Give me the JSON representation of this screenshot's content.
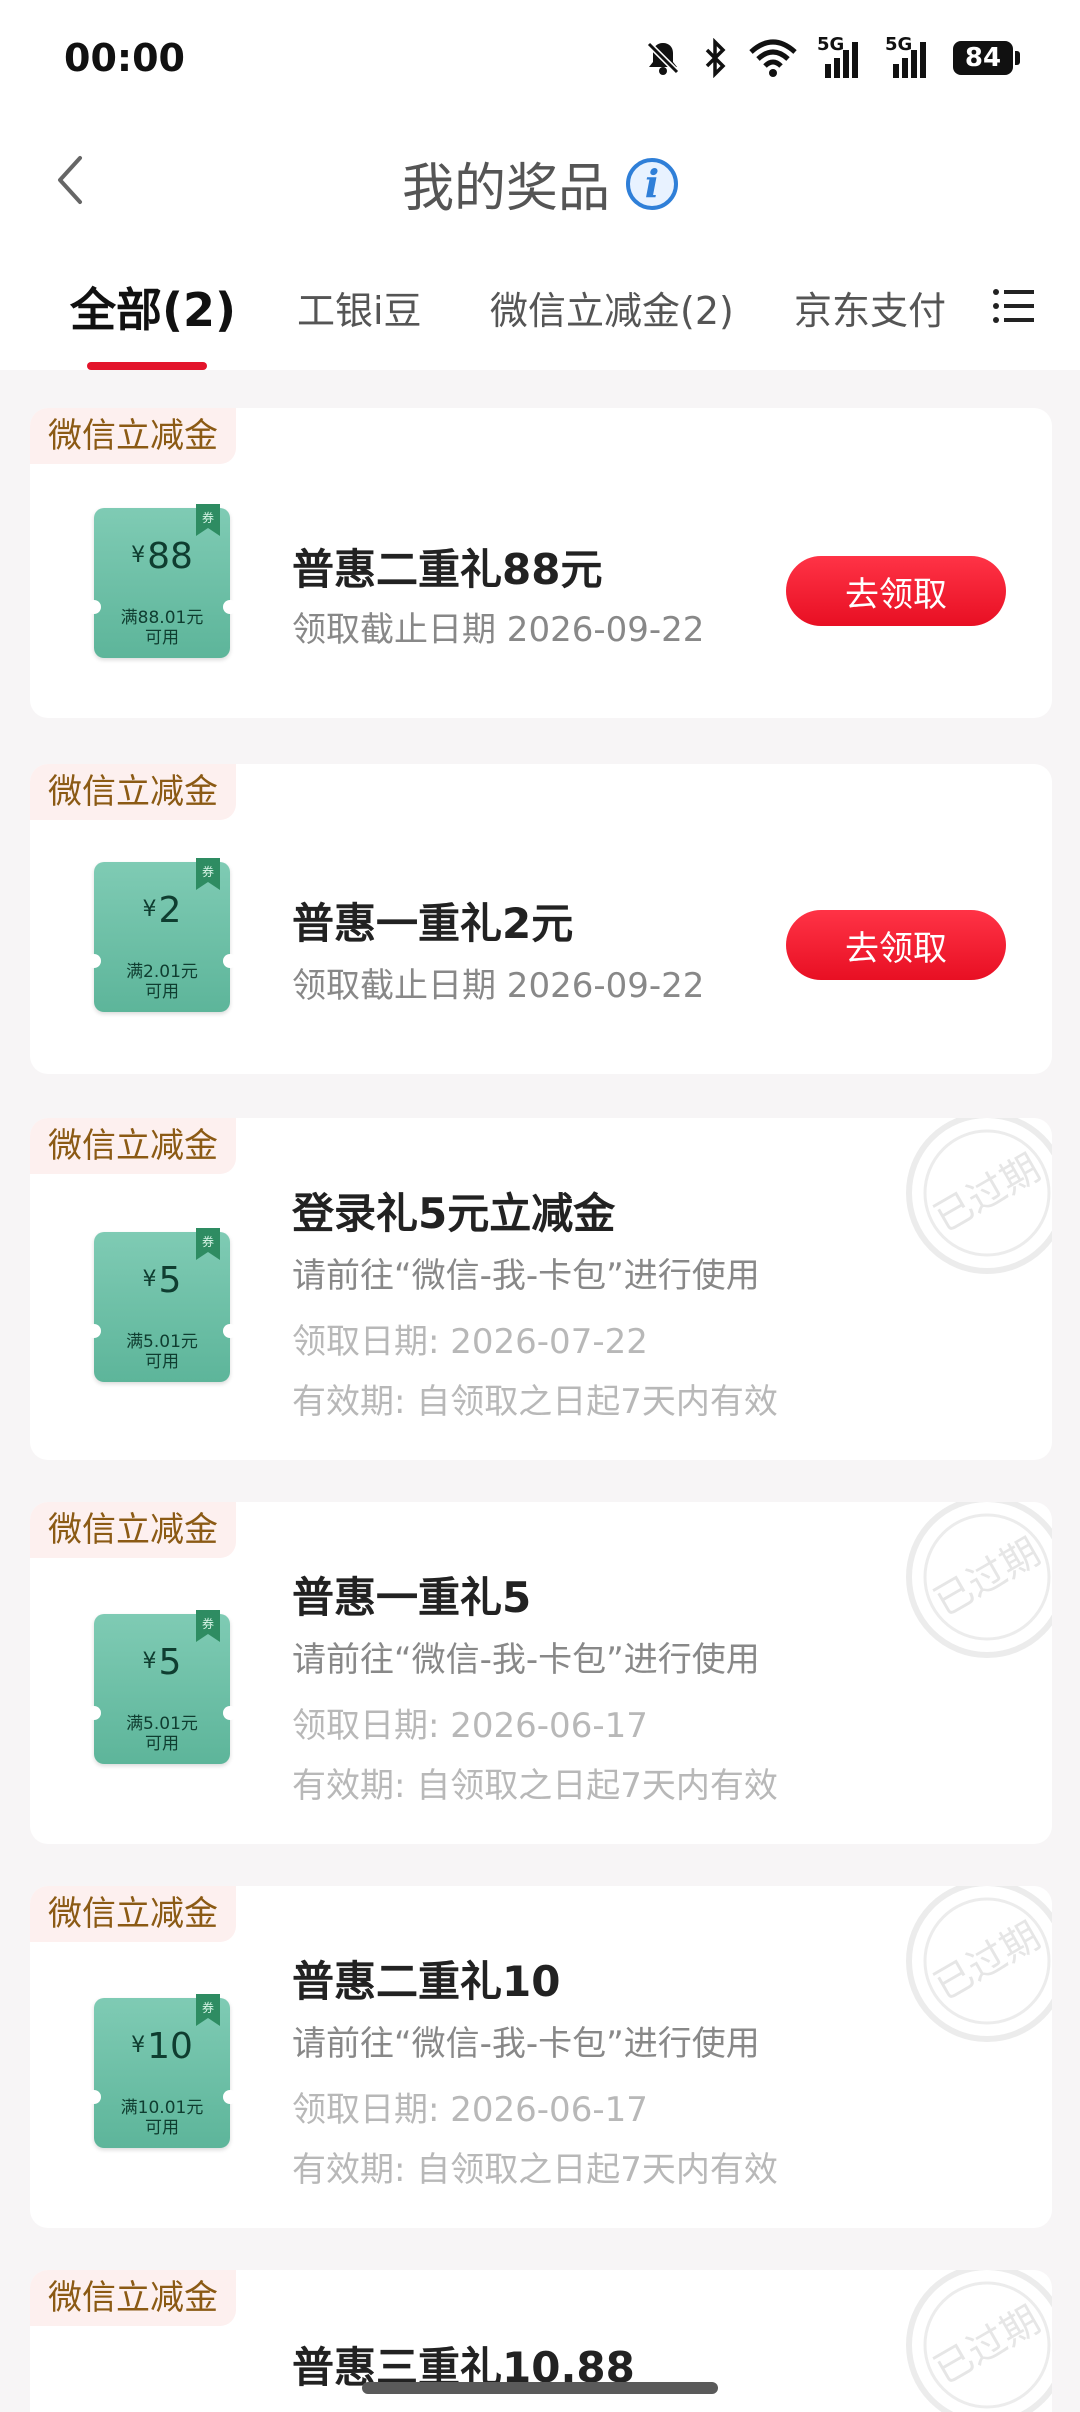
{
  "status_bar": {
    "time": "00:00",
    "battery": "84",
    "signal_label_1": "5G",
    "signal_label_2": "5G"
  },
  "header": {
    "title": "我的奖品"
  },
  "tabs": [
    {
      "label": "全部(2)",
      "active": true
    },
    {
      "label": "工银i豆",
      "active": false
    },
    {
      "label": "微信立减金(2)",
      "active": false
    },
    {
      "label": "京东支付",
      "active": false
    }
  ],
  "cards": [
    {
      "tag": "微信立减金",
      "coupon_amount": "88",
      "coupon_currency": "¥",
      "coupon_condition": "满88.01元",
      "coupon_condition2": "可用",
      "ribbon": "券",
      "title": "普惠二重礼88元",
      "deadline": "领取截止日期 2026-09-22",
      "button": "去领取"
    },
    {
      "tag": "微信立减金",
      "coupon_amount": "2",
      "coupon_currency": "¥",
      "coupon_condition": "满2.01元",
      "coupon_condition2": "可用",
      "ribbon": "券",
      "title": "普惠一重礼2元",
      "deadline": "领取截止日期 2026-09-22",
      "button": "去领取"
    },
    {
      "tag": "微信立减金",
      "coupon_amount": "5",
      "coupon_currency": "¥",
      "coupon_condition": "满5.01元",
      "coupon_condition2": "可用",
      "ribbon": "券",
      "title": "登录礼5元立减金",
      "usage": "请前往“微信-我-卡包”进行使用",
      "receive_date": "领取日期: 2026-07-22",
      "validity": "有效期: 自领取之日起7天内有效",
      "stamp": "已过期"
    },
    {
      "tag": "微信立减金",
      "coupon_amount": "5",
      "coupon_currency": "¥",
      "coupon_condition": "满5.01元",
      "coupon_condition2": "可用",
      "ribbon": "券",
      "title": "普惠一重礼5",
      "usage": "请前往“微信-我-卡包”进行使用",
      "receive_date": "领取日期: 2026-06-17",
      "validity": "有效期: 自领取之日起7天内有效",
      "stamp": "已过期"
    },
    {
      "tag": "微信立减金",
      "coupon_amount": "10",
      "coupon_currency": "¥",
      "coupon_condition": "满10.01元",
      "coupon_condition2": "可用",
      "ribbon": "券",
      "title": "普惠二重礼10",
      "usage": "请前往“微信-我-卡包”进行使用",
      "receive_date": "领取日期: 2026-06-17",
      "validity": "有效期: 自领取之日起7天内有效",
      "stamp": "已过期"
    },
    {
      "tag": "微信立减金",
      "title": "普惠三重礼10.88",
      "stamp": "已过期"
    }
  ],
  "colors": {
    "accent": "#e3142b",
    "coupon": "#6cc0a6",
    "tag_text": "#8b5a14"
  }
}
